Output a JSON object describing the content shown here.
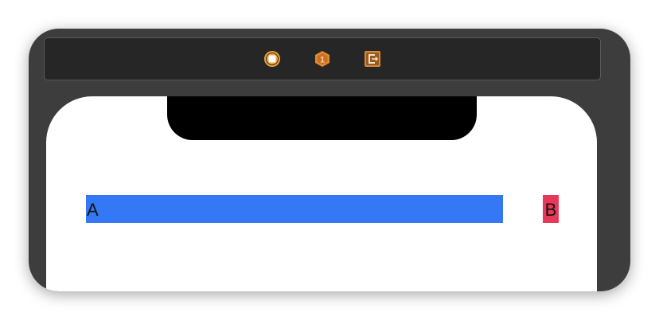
{
  "scene_toolbar": {
    "icons": [
      {
        "name": "view-controller-icon",
        "color": "#f0a23a"
      },
      {
        "name": "first-responder-icon",
        "color": "#e08a32"
      },
      {
        "name": "exit-icon",
        "color": "#d8883a"
      }
    ]
  },
  "canvas": {
    "label_a": {
      "text": "A",
      "background": "#3578f6"
    },
    "label_b": {
      "text": "B",
      "background": "#e7385a"
    }
  }
}
